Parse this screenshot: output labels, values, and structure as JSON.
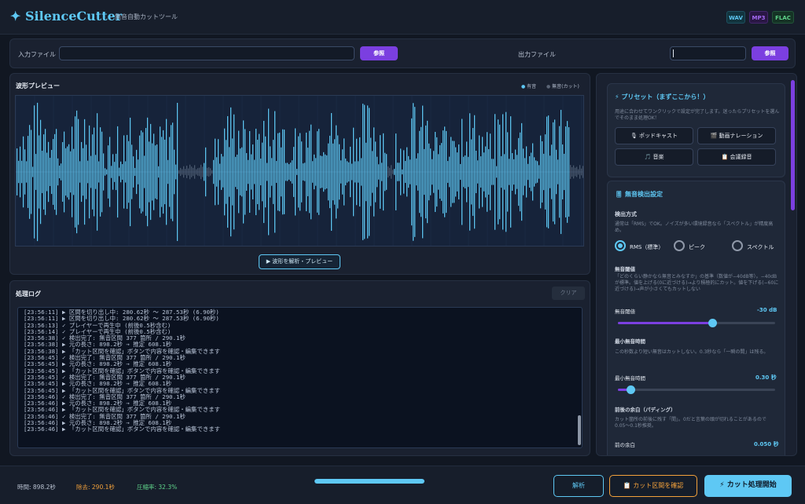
{
  "app": {
    "title": "SilenceCutter",
    "logo_glyph": "✦",
    "subtitle": "無音自動カットツール",
    "formats": [
      "WAV",
      "MP3",
      "FLAC"
    ]
  },
  "files": {
    "input_label": "入力ファイル",
    "input_value": "",
    "input_browse": "参照",
    "output_label": "出力ファイル",
    "output_value": "",
    "output_browse": "参照"
  },
  "waveform": {
    "title": "波形プレビュー",
    "legend_voiced": "有音",
    "legend_silent": "無音(カット)",
    "analyze_button": "▶ 波形を解析・プレビュー"
  },
  "log": {
    "title": "処理ログ",
    "clear_button": "クリア",
    "lines": [
      "[23:56:11] ▶ 区間を切り出し中: 280.62秒 〜 287.53秒 (6.90秒)",
      "[23:56:11] ▶ 区間を切り出し中: 280.62秒 〜 287.53秒 (6.90秒)",
      "[23:56:13] ✓ プレイヤーで再生中 (前後0.5秒含む)",
      "[23:56:14] ✓ プレイヤーで再生中 (前後0.5秒含む)",
      "[23:56:38] ✓ 検出完了: 無音区間 377 箇所 / 290.1秒",
      "[23:56:38] ▶ 元の長さ: 898.2秒 → 推定 608.1秒",
      "[23:56:38] ▶ 「カット区間を確認」ボタンで内容を確認・編集できます",
      "[23:56:45] ✓ 検出完了: 無音区間 377 箇所 / 290.1秒",
      "[23:56:45] ▶ 元の長さ: 898.2秒 → 推定 608.1秒",
      "[23:56:45] ▶ 「カット区間を確認」ボタンで内容を確認・編集できます",
      "[23:56:45] ✓ 検出完了: 無音区間 377 箇所 / 290.1秒",
      "[23:56:45] ▶ 元の長さ: 898.2秒 → 推定 608.1秒",
      "[23:56:45] ▶ 「カット区間を確認」ボタンで内容を確認・編集できます",
      "[23:56:46] ✓ 検出完了: 無音区間 377 箇所 / 290.1秒",
      "[23:56:46] ▶ 元の長さ: 898.2秒 → 推定 608.1秒",
      "[23:56:46] ▶ 「カット区間を確認」ボタンで内容を確認・編集できます",
      "[23:56:46] ✓ 検出完了: 無音区間 377 箇所 / 290.1秒",
      "[23:56:46] ▶ 元の長さ: 898.2秒 → 推定 608.1秒",
      "[23:56:46] ▶ 「カット区間を確認」ボタンで内容を確認・編集できます"
    ]
  },
  "presets": {
    "title": "⚡ プリセット（まずここから！）",
    "description": "用途に合わせてワンクリックで設定が完了します。迷ったらプリセットを選んでそのまま処理OK！",
    "buttons": [
      "🎙 ポッドキャスト",
      "🎬 動画ナレーション",
      "🎵 音楽",
      "📋 会議録音"
    ]
  },
  "detection": {
    "title": "🎚 無音検出設定",
    "method_label": "検出方式",
    "method_help": "通常は「RMS」でOK。ノイズが多い環境録音なら「スペクトル」が精度高め。",
    "options": [
      "RMS（標準）",
      "ピーク",
      "スペクトル"
    ],
    "selected_option": "RMS（標準）",
    "threshold_section": "無音閾値",
    "threshold_help": "「どのくらい静かなら無音とみなすか」の基準（数値が−40dB等）。−40dBが標準。値を上げる(0に近づける)→より積極的にカット。値を下げる(−60に近づける)→声が小さくてもカットしない",
    "threshold_label": "無音閾値",
    "threshold_value": "-30 dB",
    "threshold_level": 0.6,
    "min_section": "最小無音時間",
    "min_help": "この秒数より短い無音はカットしない。0.3秒なら「一瞬の間」は残る。",
    "min_label": "最小無音時間",
    "min_value": "0.30 秒",
    "min_level": 0.08,
    "padding_section": "前後の余白（パディング）",
    "padding_help": "カット箇所の前後に残す「間」。0だと言葉の頭が切れることがあるので0.05〜0.1秒推奨。",
    "front_label": "前の余白",
    "front_value": "0.050 秒"
  },
  "status": {
    "duration": "時間: 898.2秒",
    "removed": "除去: 290.1秒",
    "ratio": "圧縮率: 32.3%",
    "progress": 1.0
  },
  "actions": {
    "analyze": "解析",
    "review": "📋 カット区間を確認",
    "start": "⚡ カット処理開始"
  },
  "colors": {
    "accent": "#5ec8f4",
    "purple": "#7b3fe0",
    "orange": "#f3a13b",
    "green": "#5fd38a"
  }
}
